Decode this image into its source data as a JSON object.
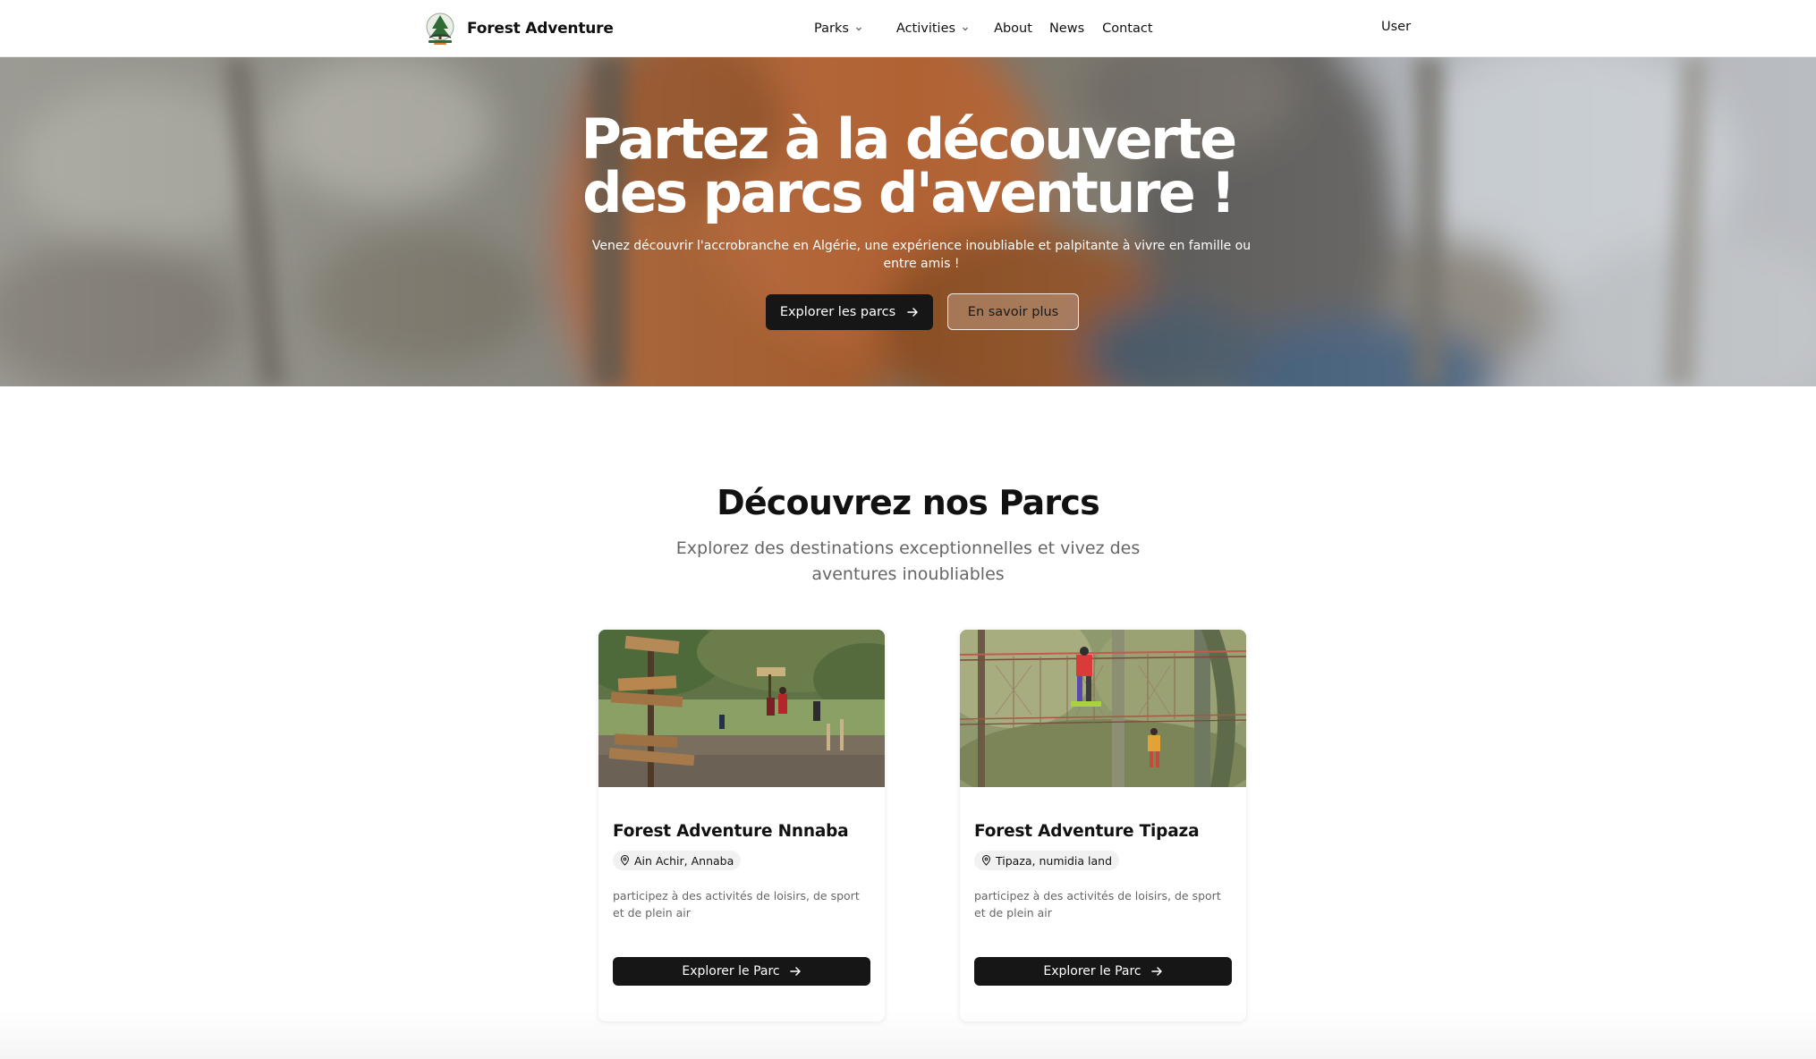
{
  "nav": {
    "brand_name": "Forest Adventure",
    "items": [
      {
        "label": "Parks",
        "has_dropdown": true
      },
      {
        "label": "Activities",
        "has_dropdown": true
      },
      {
        "label": "About",
        "has_dropdown": false
      },
      {
        "label": "News",
        "has_dropdown": false
      },
      {
        "label": "Contact",
        "has_dropdown": false
      }
    ],
    "user_label": "User"
  },
  "hero": {
    "title_line1": "Partez à la découverte",
    "title_line2": "des parcs d'aventure !",
    "subtitle": "Venez découvrir l'accrobranche en Algérie, une expérience inoubliable et palpitante à vivre en famille ou entre amis !",
    "primary_button": "Explorer les parcs",
    "secondary_button": "En savoir plus"
  },
  "parks_section": {
    "title": "Découvrez nos Parcs",
    "subtitle": "Explorez des destinations exceptionnelles et vivez des aventures inoubliables",
    "cards": [
      {
        "title": "Forest Adventure Nnnaba",
        "location": "Ain Achir, Annaba",
        "description": "participez à des activités de loisirs, de sport et de plein air",
        "button": "Explorer le Parc"
      },
      {
        "title": "Forest Adventure Tipaza",
        "location": "Tipaza, numidia land",
        "description": "participez à des activités de loisirs, de sport et de plein air",
        "button": "Explorer le Parc"
      }
    ]
  },
  "colors": {
    "primary_button_bg": "#161616",
    "hero_orange": "#c9703a",
    "muted_text": "#666666"
  },
  "icons": {
    "dropdown": "chevron-down-icon",
    "button_arrow": "arrow-right-icon",
    "location": "map-pin-icon"
  }
}
